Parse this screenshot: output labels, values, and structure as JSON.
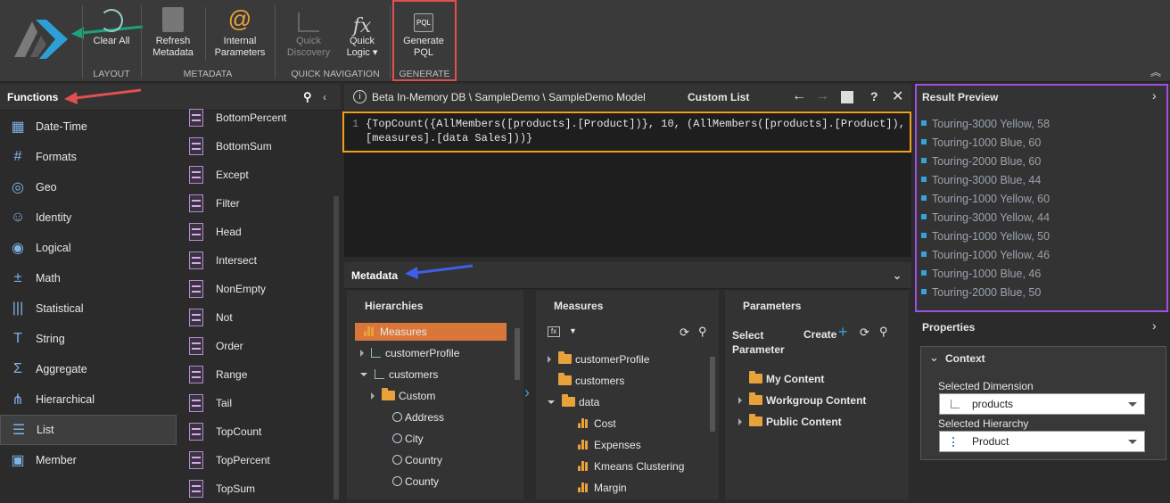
{
  "ribbon": {
    "clear_all": "Clear All",
    "layout_group": "LAYOUT",
    "refresh_metadata": "Refresh\nMetadata",
    "internal_parameters": "Internal\nParameters",
    "metadata_group": "METADATA",
    "quick_discovery": "Quick\nDiscovery",
    "quick_logic": "Quick\nLogic ▾",
    "quick_nav_group": "QUICK NAVIGATION",
    "generate_pql": "Generate\nPQL",
    "generate_group": "GENERATE",
    "pql_badge": "PQL"
  },
  "functions": {
    "title": "Functions",
    "categories": [
      "Date-Time",
      "Formats",
      "Geo",
      "Identity",
      "Logical",
      "Math",
      "Statistical",
      "String",
      "Aggregate",
      "Hierarchical",
      "List",
      "Member"
    ],
    "list": [
      "BottomPercent",
      "BottomSum",
      "Except",
      "Filter",
      "Head",
      "Intersect",
      "NonEmpty",
      "Not",
      "Order",
      "Range",
      "Tail",
      "TopCount",
      "TopPercent",
      "TopSum"
    ]
  },
  "editor": {
    "breadcrumb": "Beta In-Memory DB \\ SampleDemo \\ SampleDemo Model",
    "mode": "Custom List",
    "line_no": "1",
    "code_line1": "{TopCount({AllMembers([products].[Product])}, 10, (AllMembers([products].[Product]),",
    "code_line2": "[measures].[data Sales]))}"
  },
  "metadata": {
    "title": "Metadata",
    "hierarchies_title": "Hierarchies",
    "hierarchies": [
      "Measures",
      "customerProfile",
      "customers",
      "Custom",
      "Address",
      "City",
      "Country",
      "County"
    ],
    "measures_title": "Measures",
    "measures": [
      "customerProfile",
      "customers",
      "data",
      "Cost",
      "Expenses",
      "Kmeans Clustering",
      "Margin"
    ],
    "parameters_title": "Parameters",
    "select_parameter": "Select\nParameter",
    "create": "Create",
    "parameters": [
      "My Content",
      "Workgroup Content",
      "Public Content"
    ]
  },
  "results": {
    "title": "Result Preview",
    "items": [
      "Touring-3000 Yellow, 58",
      "Touring-1000 Blue, 60",
      "Touring-2000 Blue, 60",
      "Touring-3000 Blue, 44",
      "Touring-1000 Yellow, 60",
      "Touring-3000 Yellow, 44",
      "Touring-1000 Yellow, 50",
      "Touring-1000 Yellow, 46",
      "Touring-1000 Blue, 46",
      "Touring-2000 Blue, 50"
    ]
  },
  "properties": {
    "title": "Properties",
    "context": "Context",
    "dim_label": "Selected Dimension",
    "dim_value": "products",
    "hier_label": "Selected Hierarchy",
    "hier_value": "Product"
  },
  "colors": {
    "annot_red": "#e05050",
    "annot_green": "#1aa37a",
    "annot_blue": "#3f5fe8",
    "annot_orange": "#f0a020",
    "annot_purple": "#a050e0",
    "accent": "#d9773a"
  }
}
